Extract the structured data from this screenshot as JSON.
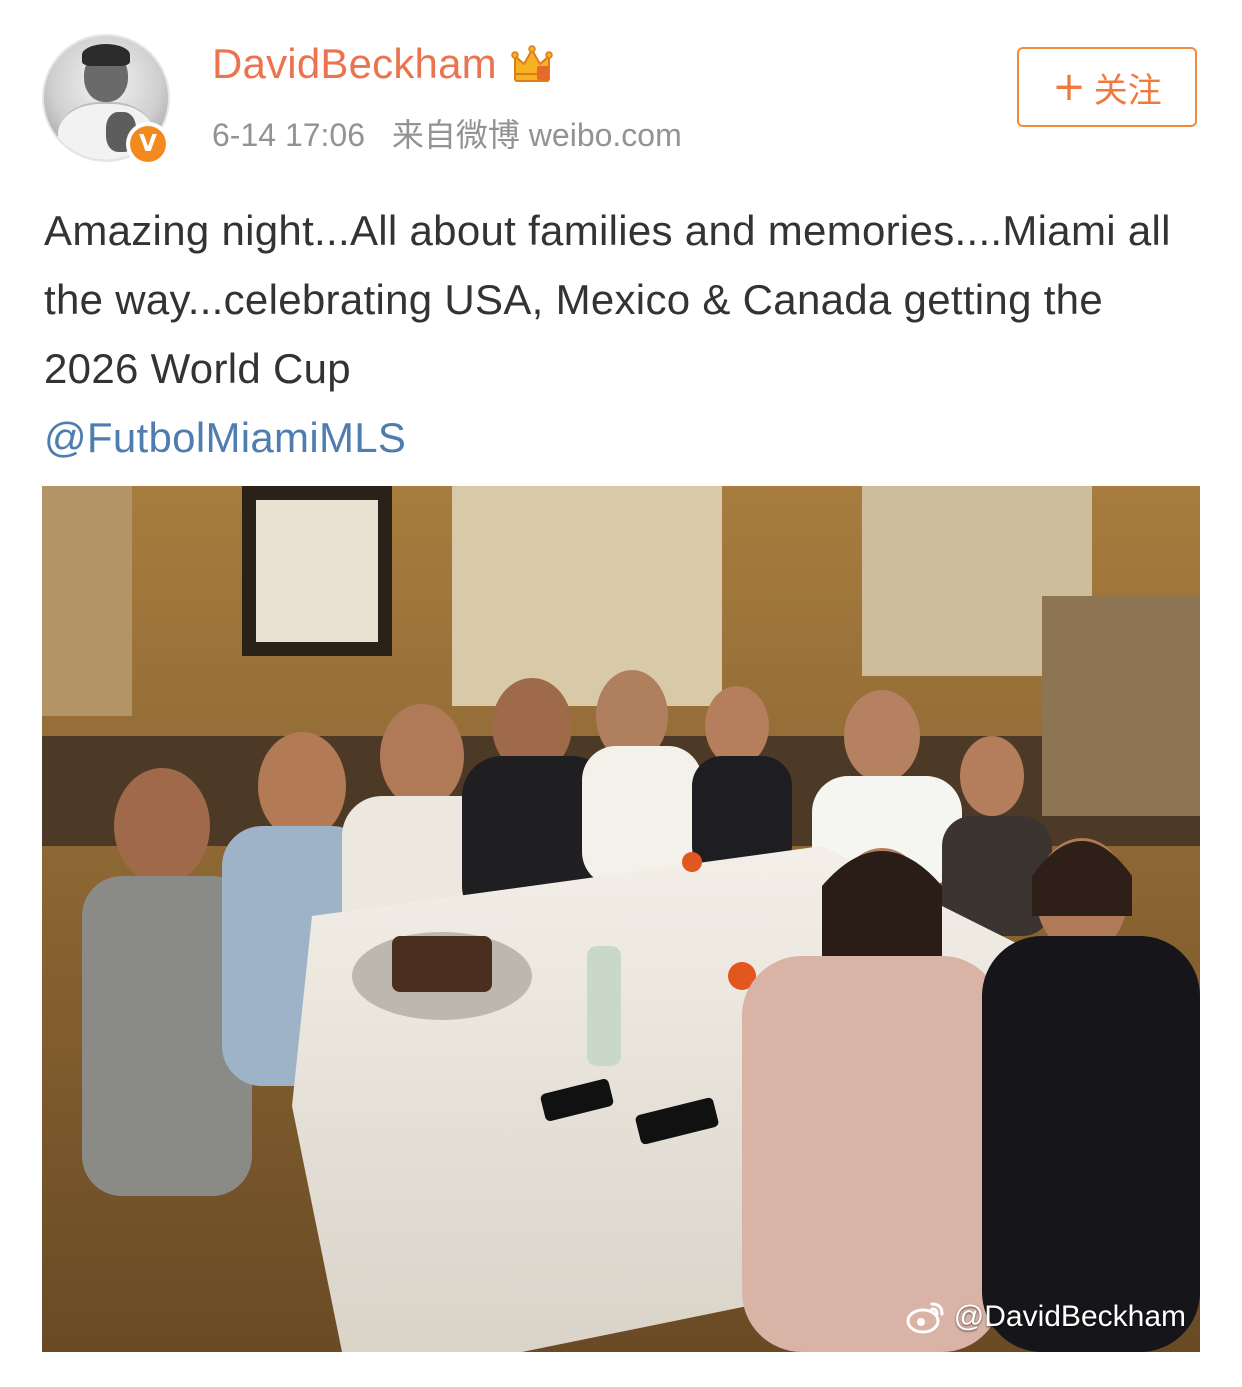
{
  "user": {
    "name": "DavidBeckham",
    "verified_badge": "V",
    "crown_icon": "crown-icon",
    "avatar_icon": "avatar-icon"
  },
  "meta": {
    "date": "6-14 17:06",
    "source": "来自微博 weibo.com"
  },
  "follow_button": {
    "plus": "+",
    "label": "关注"
  },
  "post": {
    "text": "Amazing night...All about families and memories....Miami all the way...celebrating USA, Mexico & Canada getting the 2026 World Cup",
    "mention": "@FutbolMiamiMLS"
  },
  "photo": {
    "watermark": "@DavidBeckham",
    "watermark_icon": "weibo-logo-icon"
  },
  "colors": {
    "username": "#eb7350",
    "mention": "#507daf",
    "follow_border": "#f08a3e",
    "meta_text": "#939393",
    "body_text": "#333333",
    "badge": "#f28a1e"
  }
}
